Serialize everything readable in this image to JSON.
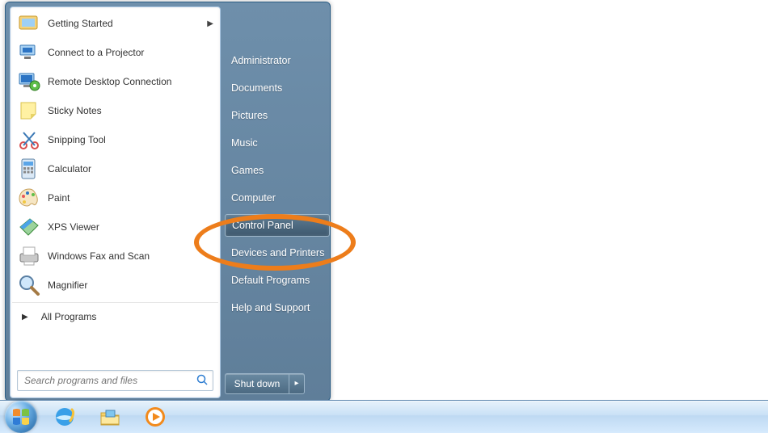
{
  "profile_icon": "control-panel",
  "programs": [
    {
      "label": "Getting Started",
      "icon": "getting-started",
      "has_submenu": true
    },
    {
      "label": "Connect to a Projector",
      "icon": "projector",
      "has_submenu": false
    },
    {
      "label": "Remote Desktop Connection",
      "icon": "remote-desktop",
      "has_submenu": false
    },
    {
      "label": "Sticky Notes",
      "icon": "sticky-notes",
      "has_submenu": false
    },
    {
      "label": "Snipping Tool",
      "icon": "snipping-tool",
      "has_submenu": false
    },
    {
      "label": "Calculator",
      "icon": "calculator",
      "has_submenu": false
    },
    {
      "label": "Paint",
      "icon": "paint",
      "has_submenu": false
    },
    {
      "label": "XPS Viewer",
      "icon": "xps-viewer",
      "has_submenu": false
    },
    {
      "label": "Windows Fax and Scan",
      "icon": "fax-scan",
      "has_submenu": false
    },
    {
      "label": "Magnifier",
      "icon": "magnifier",
      "has_submenu": false
    }
  ],
  "all_programs_label": "All Programs",
  "search": {
    "placeholder": "Search programs and files"
  },
  "right_items": [
    {
      "label": "Administrator",
      "highlight": false
    },
    {
      "label": "Documents",
      "highlight": false
    },
    {
      "label": "Pictures",
      "highlight": false
    },
    {
      "label": "Music",
      "highlight": false
    },
    {
      "label": "Games",
      "highlight": false
    },
    {
      "label": "Computer",
      "highlight": false
    },
    {
      "label": "Control Panel",
      "highlight": true
    },
    {
      "label": "Devices and Printers",
      "highlight": false
    },
    {
      "label": "Default Programs",
      "highlight": false
    },
    {
      "label": "Help and Support",
      "highlight": false
    }
  ],
  "shutdown_label": "Shut down",
  "taskbar": {
    "pinned": [
      {
        "name": "internet-explorer"
      },
      {
        "name": "windows-explorer"
      },
      {
        "name": "media-player"
      }
    ]
  },
  "annotation": {
    "target": "Control Panel",
    "color": "#ed7d1b"
  }
}
